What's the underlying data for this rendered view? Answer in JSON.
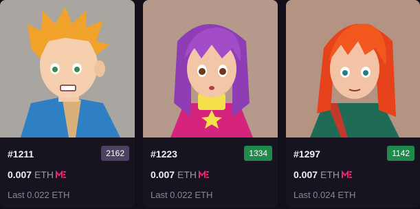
{
  "cards": [
    {
      "token_id": "#1211",
      "rank": "2162",
      "rank_color": "#4e4262",
      "price": "0.007",
      "currency": "ETH",
      "last_sale": "Last 0.022 ETH",
      "marketplace_icon": "magic-eden-icon"
    },
    {
      "token_id": "#1223",
      "rank": "1334",
      "rank_color": "#1f8a4c",
      "price": "0.007",
      "currency": "ETH",
      "last_sale": "Last 0.022 ETH",
      "marketplace_icon": "magic-eden-icon"
    },
    {
      "token_id": "#1297",
      "rank": "1142",
      "rank_color": "#1f8a4c",
      "price": "0.007",
      "currency": "ETH",
      "last_sale": "Last 0.024 ETH",
      "marketplace_icon": "magic-eden-icon"
    }
  ],
  "colors": {
    "accent": "#e42575",
    "page_bg": "#120f1b",
    "card_bg": "#18141f"
  }
}
